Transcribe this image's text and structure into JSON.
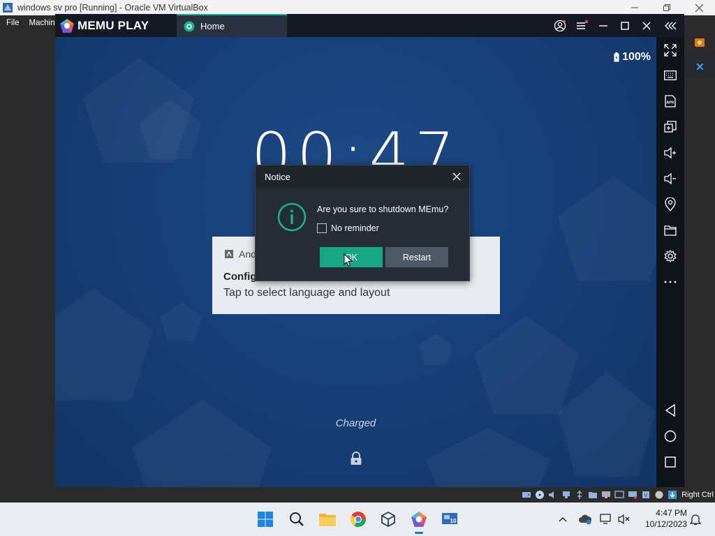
{
  "vbox": {
    "title": "windows  sv pro [Running] - Oracle VM VirtualBox",
    "menu": [
      "File",
      "Machine"
    ],
    "host_key": "Right Ctrl"
  },
  "memu": {
    "logo": "MEMU PLAY",
    "tab_label": "Home",
    "accent": "#17b38e"
  },
  "android": {
    "battery": "100%",
    "clock": "00:47",
    "notification": {
      "app": "And",
      "title": "Config",
      "text": "Tap to select language and layout"
    },
    "charged": "Charged"
  },
  "dialog": {
    "title": "Notice",
    "message": "Are you sure to shutdown MEmu?",
    "checkbox_label": "No reminder",
    "ok_label": "OK",
    "restart_label": "Restart"
  },
  "taskbar": {
    "time": "4:47 PM",
    "date": "10/12/2023"
  }
}
